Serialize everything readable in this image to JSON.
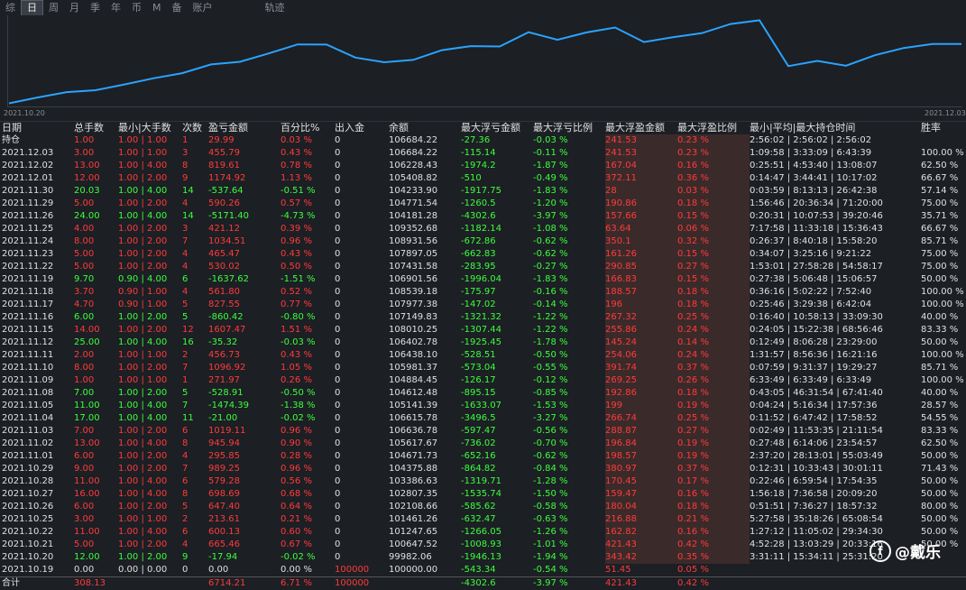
{
  "tabs": [
    "综",
    "日",
    "周",
    "月",
    "季",
    "年",
    "币",
    "M",
    "备",
    "账户",
    "轨迹"
  ],
  "active_tab": "日",
  "equity_chart": {
    "start_label": "2021.10.20",
    "end_label": "2021.12.03",
    "values": [
      99982.06,
      100647.52,
      101247.65,
      101461.26,
      102108.66,
      102807.35,
      103386.63,
      104375.88,
      104671.73,
      105617.67,
      106636.78,
      106615.78,
      105141.39,
      104612.48,
      104884.45,
      105981.37,
      106438.1,
      106402.78,
      108010.25,
      107149.83,
      107977.38,
      108539.18,
      106901.56,
      107431.58,
      107897.05,
      108931.56,
      109352.68,
      104181.28,
      104771.54,
      104233.9,
      105408.82,
      106228.43,
      106684.22,
      106684.22
    ],
    "color": "#2aa3ff"
  },
  "columns": [
    "日期",
    "总手数",
    "最小|大手数",
    "次数",
    "盈亏金额",
    "百分比%",
    "出入金",
    "余额",
    "最大浮亏金额",
    "最大浮亏比例",
    "最大浮盈金额",
    "最大浮盈比例",
    "最小|平均|最大持仓时间",
    "胜率"
  ],
  "rows": [
    {
      "date": "持仓",
      "lots": "1.00",
      "minmax": "1.00 | 1.00",
      "n": "1",
      "pl": "29.99",
      "pct": "0.03 %",
      "io": "0",
      "bal": "106684.22",
      "mfl": "-27.36",
      "mflp": "-0.03 %",
      "mfp": "241.53",
      "mfpp": "0.23 %",
      "hold": "2:56:02 | 2:56:02 | 2:56:02",
      "win": "",
      "s": "red"
    },
    {
      "date": "2021.12.03",
      "lots": "3.00",
      "minmax": "1.00 | 1.00",
      "n": "3",
      "pl": "455.79",
      "pct": "0.43 %",
      "io": "0",
      "bal": "106684.22",
      "mfl": "-115.14",
      "mflp": "-0.11 %",
      "mfp": "241.53",
      "mfpp": "0.23 %",
      "hold": "1:09:58 | 3:33:09 | 6:43:39",
      "win": "100.00 %",
      "s": "red"
    },
    {
      "date": "2021.12.02",
      "lots": "13.00",
      "minmax": "1.00 | 4.00",
      "n": "8",
      "pl": "819.61",
      "pct": "0.78 %",
      "io": "0",
      "bal": "106228.43",
      "mfl": "-1974.2",
      "mflp": "-1.87 %",
      "mfp": "167.04",
      "mfpp": "0.16 %",
      "hold": "0:25:51 | 4:53:40 | 13:08:07",
      "win": "62.50 %",
      "s": "red"
    },
    {
      "date": "2021.12.01",
      "lots": "12.00",
      "minmax": "1.00 | 2.00",
      "n": "9",
      "pl": "1174.92",
      "pct": "1.13 %",
      "io": "0",
      "bal": "105408.82",
      "mfl": "-510",
      "mflp": "-0.49 %",
      "mfp": "372.11",
      "mfpp": "0.36 %",
      "hold": "0:14:47 | 3:44:41 | 10:17:02",
      "win": "66.67 %",
      "s": "red"
    },
    {
      "date": "2021.11.30",
      "lots": "20.03",
      "minmax": "1.00 | 4.00",
      "n": "14",
      "pl": "-537.64",
      "pct": "-0.51 %",
      "io": "0",
      "bal": "104233.90",
      "mfl": "-1917.75",
      "mflp": "-1.83 %",
      "mfp": "28",
      "mfpp": "0.03 %",
      "hold": "0:03:59 | 8:13:13 | 26:42:38",
      "win": "57.14 %",
      "s": "green"
    },
    {
      "date": "2021.11.29",
      "lots": "5.00",
      "minmax": "1.00 | 2.00",
      "n": "4",
      "pl": "590.26",
      "pct": "0.57 %",
      "io": "0",
      "bal": "104771.54",
      "mfl": "-1260.5",
      "mflp": "-1.20 %",
      "mfp": "190.86",
      "mfpp": "0.18 %",
      "hold": "1:56:46 | 20:36:34 | 71:20:00",
      "win": "75.00 %",
      "s": "red"
    },
    {
      "date": "2021.11.26",
      "lots": "24.00",
      "minmax": "1.00 | 4.00",
      "n": "14",
      "pl": "-5171.40",
      "pct": "-4.73 %",
      "io": "0",
      "bal": "104181.28",
      "mfl": "-4302.6",
      "mflp": "-3.97 %",
      "mfp": "157.66",
      "mfpp": "0.15 %",
      "hold": "0:20:31 | 10:07:53 | 39:20:46",
      "win": "35.71 %",
      "s": "green"
    },
    {
      "date": "2021.11.25",
      "lots": "4.00",
      "minmax": "1.00 | 2.00",
      "n": "3",
      "pl": "421.12",
      "pct": "0.39 %",
      "io": "0",
      "bal": "109352.68",
      "mfl": "-1182.14",
      "mflp": "-1.08 %",
      "mfp": "63.64",
      "mfpp": "0.06 %",
      "hold": "7:17:58 | 11:33:18 | 15:36:43",
      "win": "66.67 %",
      "s": "red"
    },
    {
      "date": "2021.11.24",
      "lots": "8.00",
      "minmax": "1.00 | 2.00",
      "n": "7",
      "pl": "1034.51",
      "pct": "0.96 %",
      "io": "0",
      "bal": "108931.56",
      "mfl": "-672.86",
      "mflp": "-0.62 %",
      "mfp": "350.1",
      "mfpp": "0.32 %",
      "hold": "0:26:37 | 8:40:18 | 15:58:20",
      "win": "85.71 %",
      "s": "red"
    },
    {
      "date": "2021.11.23",
      "lots": "5.00",
      "minmax": "1.00 | 2.00",
      "n": "4",
      "pl": "465.47",
      "pct": "0.43 %",
      "io": "0",
      "bal": "107897.05",
      "mfl": "-662.83",
      "mflp": "-0.62 %",
      "mfp": "161.26",
      "mfpp": "0.15 %",
      "hold": "0:34:07 | 3:25:16 | 9:21:22",
      "win": "75.00 %",
      "s": "red"
    },
    {
      "date": "2021.11.22",
      "lots": "5.00",
      "minmax": "1.00 | 2.00",
      "n": "4",
      "pl": "530.02",
      "pct": "0.50 %",
      "io": "0",
      "bal": "107431.58",
      "mfl": "-283.95",
      "mflp": "-0.27 %",
      "mfp": "290.85",
      "mfpp": "0.27 %",
      "hold": "1:53:01 | 27:58:28 | 54:58:17",
      "win": "75.00 %",
      "s": "red"
    },
    {
      "date": "2021.11.19",
      "lots": "9.70",
      "minmax": "0.90 | 4.00",
      "n": "6",
      "pl": "-1637.62",
      "pct": "-1.51 %",
      "io": "0",
      "bal": "106901.56",
      "mfl": "-1996.04",
      "mflp": "-1.83 %",
      "mfp": "166.83",
      "mfpp": "0.15 %",
      "hold": "0:27:38 | 5:06:48 | 15:06:57",
      "win": "50.00 %",
      "s": "green"
    },
    {
      "date": "2021.11.18",
      "lots": "3.70",
      "minmax": "0.90 | 1.00",
      "n": "4",
      "pl": "561.80",
      "pct": "0.52 %",
      "io": "0",
      "bal": "108539.18",
      "mfl": "-175.97",
      "mflp": "-0.16 %",
      "mfp": "188.57",
      "mfpp": "0.18 %",
      "hold": "0:36:16 | 5:02:22 | 7:52:40",
      "win": "100.00 %",
      "s": "red"
    },
    {
      "date": "2021.11.17",
      "lots": "4.70",
      "minmax": "0.90 | 1.00",
      "n": "5",
      "pl": "827.55",
      "pct": "0.77 %",
      "io": "0",
      "bal": "107977.38",
      "mfl": "-147.02",
      "mflp": "-0.14 %",
      "mfp": "196",
      "mfpp": "0.18 %",
      "hold": "0:25:46 | 3:29:38 | 6:42:04",
      "win": "100.00 %",
      "s": "red"
    },
    {
      "date": "2021.11.16",
      "lots": "6.00",
      "minmax": "1.00 | 2.00",
      "n": "5",
      "pl": "-860.42",
      "pct": "-0.80 %",
      "io": "0",
      "bal": "107149.83",
      "mfl": "-1321.32",
      "mflp": "-1.22 %",
      "mfp": "267.32",
      "mfpp": "0.25 %",
      "hold": "0:16:40 | 10:58:13 | 33:09:30",
      "win": "40.00 %",
      "s": "green"
    },
    {
      "date": "2021.11.15",
      "lots": "14.00",
      "minmax": "1.00 | 2.00",
      "n": "12",
      "pl": "1607.47",
      "pct": "1.51 %",
      "io": "0",
      "bal": "108010.25",
      "mfl": "-1307.44",
      "mflp": "-1.22 %",
      "mfp": "255.86",
      "mfpp": "0.24 %",
      "hold": "0:24:05 | 15:22:38 | 68:56:46",
      "win": "83.33 %",
      "s": "red"
    },
    {
      "date": "2021.11.12",
      "lots": "25.00",
      "minmax": "1.00 | 4.00",
      "n": "16",
      "pl": "-35.32",
      "pct": "-0.03 %",
      "io": "0",
      "bal": "106402.78",
      "mfl": "-1925.45",
      "mflp": "-1.78 %",
      "mfp": "145.24",
      "mfpp": "0.14 %",
      "hold": "0:12:49 | 8:06:28 | 23:29:00",
      "win": "50.00 %",
      "s": "green"
    },
    {
      "date": "2021.11.11",
      "lots": "2.00",
      "minmax": "1.00 | 1.00",
      "n": "2",
      "pl": "456.73",
      "pct": "0.43 %",
      "io": "0",
      "bal": "106438.10",
      "mfl": "-528.51",
      "mflp": "-0.50 %",
      "mfp": "254.06",
      "mfpp": "0.24 %",
      "hold": "1:31:57 | 8:56:36 | 16:21:16",
      "win": "100.00 %",
      "s": "red"
    },
    {
      "date": "2021.11.10",
      "lots": "8.00",
      "minmax": "1.00 | 2.00",
      "n": "7",
      "pl": "1096.92",
      "pct": "1.05 %",
      "io": "0",
      "bal": "105981.37",
      "mfl": "-573.04",
      "mflp": "-0.55 %",
      "mfp": "391.74",
      "mfpp": "0.37 %",
      "hold": "0:07:59 | 9:31:37 | 19:29:27",
      "win": "85.71 %",
      "s": "red"
    },
    {
      "date": "2021.11.09",
      "lots": "1.00",
      "minmax": "1.00 | 1.00",
      "n": "1",
      "pl": "271.97",
      "pct": "0.26 %",
      "io": "0",
      "bal": "104884.45",
      "mfl": "-126.17",
      "mflp": "-0.12 %",
      "mfp": "269.25",
      "mfpp": "0.26 %",
      "hold": "6:33:49 | 6:33:49 | 6:33:49",
      "win": "100.00 %",
      "s": "red"
    },
    {
      "date": "2021.11.08",
      "lots": "7.00",
      "minmax": "1.00 | 2.00",
      "n": "5",
      "pl": "-528.91",
      "pct": "-0.50 %",
      "io": "0",
      "bal": "104612.48",
      "mfl": "-895.15",
      "mflp": "-0.85 %",
      "mfp": "192.86",
      "mfpp": "0.18 %",
      "hold": "0:43:05 | 46:31:54 | 67:41:40",
      "win": "40.00 %",
      "s": "green"
    },
    {
      "date": "2021.11.05",
      "lots": "11.00",
      "minmax": "1.00 | 4.00",
      "n": "7",
      "pl": "-1474.39",
      "pct": "-1.38 %",
      "io": "0",
      "bal": "105141.39",
      "mfl": "-1633.07",
      "mflp": "-1.53 %",
      "mfp": "199",
      "mfpp": "0.19 %",
      "hold": "0:04:24 | 5:16:34 | 17:57:36",
      "win": "28.57 %",
      "s": "green"
    },
    {
      "date": "2021.11.04",
      "lots": "17.00",
      "minmax": "1.00 | 4.00",
      "n": "11",
      "pl": "-21.00",
      "pct": "-0.02 %",
      "io": "0",
      "bal": "106615.78",
      "mfl": "-3496.5",
      "mflp": "-3.27 %",
      "mfp": "266.74",
      "mfpp": "0.25 %",
      "hold": "0:11:52 | 6:47:42 | 17:58:52",
      "win": "54.55 %",
      "s": "green"
    },
    {
      "date": "2021.11.03",
      "lots": "7.00",
      "minmax": "1.00 | 2.00",
      "n": "6",
      "pl": "1019.11",
      "pct": "0.96 %",
      "io": "0",
      "bal": "106636.78",
      "mfl": "-597.47",
      "mflp": "-0.56 %",
      "mfp": "288.87",
      "mfpp": "0.27 %",
      "hold": "0:02:49 | 11:53:35 | 21:11:54",
      "win": "83.33 %",
      "s": "red"
    },
    {
      "date": "2021.11.02",
      "lots": "13.00",
      "minmax": "1.00 | 4.00",
      "n": "8",
      "pl": "945.94",
      "pct": "0.90 %",
      "io": "0",
      "bal": "105617.67",
      "mfl": "-736.02",
      "mflp": "-0.70 %",
      "mfp": "196.84",
      "mfpp": "0.19 %",
      "hold": "0:27:48 | 6:14:06 | 23:54:57",
      "win": "62.50 %",
      "s": "red"
    },
    {
      "date": "2021.11.01",
      "lots": "6.00",
      "minmax": "1.00 | 2.00",
      "n": "4",
      "pl": "295.85",
      "pct": "0.28 %",
      "io": "0",
      "bal": "104671.73",
      "mfl": "-652.16",
      "mflp": "-0.62 %",
      "mfp": "198.57",
      "mfpp": "0.19 %",
      "hold": "2:37:20 | 28:13:01 | 55:03:49",
      "win": "50.00 %",
      "s": "red"
    },
    {
      "date": "2021.10.29",
      "lots": "9.00",
      "minmax": "1.00 | 2.00",
      "n": "7",
      "pl": "989.25",
      "pct": "0.96 %",
      "io": "0",
      "bal": "104375.88",
      "mfl": "-864.82",
      "mflp": "-0.84 %",
      "mfp": "380.97",
      "mfpp": "0.37 %",
      "hold": "0:12:31 | 10:33:43 | 30:01:11",
      "win": "71.43 %",
      "s": "red"
    },
    {
      "date": "2021.10.28",
      "lots": "11.00",
      "minmax": "1.00 | 4.00",
      "n": "6",
      "pl": "579.28",
      "pct": "0.56 %",
      "io": "0",
      "bal": "103386.63",
      "mfl": "-1319.71",
      "mflp": "-1.28 %",
      "mfp": "170.45",
      "mfpp": "0.17 %",
      "hold": "0:22:46 | 6:59:54 | 17:54:35",
      "win": "50.00 %",
      "s": "red"
    },
    {
      "date": "2021.10.27",
      "lots": "16.00",
      "minmax": "1.00 | 4.00",
      "n": "8",
      "pl": "698.69",
      "pct": "0.68 %",
      "io": "0",
      "bal": "102807.35",
      "mfl": "-1535.74",
      "mflp": "-1.50 %",
      "mfp": "159.47",
      "mfpp": "0.16 %",
      "hold": "1:56:18 | 7:36:58 | 20:09:20",
      "win": "50.00 %",
      "s": "red"
    },
    {
      "date": "2021.10.26",
      "lots": "6.00",
      "minmax": "1.00 | 2.00",
      "n": "5",
      "pl": "647.40",
      "pct": "0.64 %",
      "io": "0",
      "bal": "102108.66",
      "mfl": "-585.62",
      "mflp": "-0.58 %",
      "mfp": "180.04",
      "mfpp": "0.18 %",
      "hold": "0:51:51 | 7:36:27 | 18:57:32",
      "win": "80.00 %",
      "s": "red"
    },
    {
      "date": "2021.10.25",
      "lots": "3.00",
      "minmax": "1.00 | 1.00",
      "n": "2",
      "pl": "213.61",
      "pct": "0.21 %",
      "io": "0",
      "bal": "101461.26",
      "mfl": "-632.47",
      "mflp": "-0.63 %",
      "mfp": "216.88",
      "mfpp": "0.21 %",
      "hold": "5:27:58 | 35:18:26 | 65:08:54",
      "win": "50.00 %",
      "s": "red"
    },
    {
      "date": "2021.10.22",
      "lots": "11.00",
      "minmax": "1.00 | 4.00",
      "n": "6",
      "pl": "600.13",
      "pct": "0.60 %",
      "io": "0",
      "bal": "101247.65",
      "mfl": "-1266.05",
      "mflp": "-1.26 %",
      "mfp": "162.82",
      "mfpp": "0.16 %",
      "hold": "1:27:12 | 11:05:02 | 29:34:30",
      "win": "50.00 %",
      "s": "red"
    },
    {
      "date": "2021.10.21",
      "lots": "5.00",
      "minmax": "1.00 | 2.00",
      "n": "4",
      "pl": "665.46",
      "pct": "0.67 %",
      "io": "0",
      "bal": "100647.52",
      "mfl": "-1008.93",
      "mflp": "-1.01 %",
      "mfp": "421.43",
      "mfpp": "0.42 %",
      "hold": "4:52:28 | 13:03:29 | 20:33:16",
      "win": "50.00 %",
      "s": "red"
    },
    {
      "date": "2021.10.20",
      "lots": "12.00",
      "minmax": "1.00 | 2.00",
      "n": "9",
      "pl": "-17.94",
      "pct": "-0.02 %",
      "io": "0",
      "bal": "99982.06",
      "mfl": "-1946.13",
      "mflp": "-1.94 %",
      "mfp": "343.42",
      "mfpp": "0.35 %",
      "hold": "3:31:11 | 15:34:11 | 25:31:20",
      "win": "",
      "s": "green"
    },
    {
      "date": "2021.10.19",
      "lots": "0.00",
      "minmax": "0.00 | 0.00",
      "n": "0",
      "pl": "0.00",
      "pct": "0.00 %",
      "io": "100000",
      "bal": "100000.00",
      "mfl": "-543.34",
      "mflp": "-0.54 %",
      "mfp": "51.45",
      "mfpp": "0.05 %",
      "hold": "",
      "win": "",
      "s": "white"
    }
  ],
  "total": {
    "date": "合计",
    "lots": "308.13",
    "pl": "6714.21",
    "pct": "6.71 %",
    "io": "100000",
    "mfl": "-4302.6",
    "mflp": "-3.97 %",
    "mfp": "421.43",
    "mfpp": "0.42 %"
  },
  "watermark": {
    "text": "@戴乐",
    "logo": "f"
  }
}
